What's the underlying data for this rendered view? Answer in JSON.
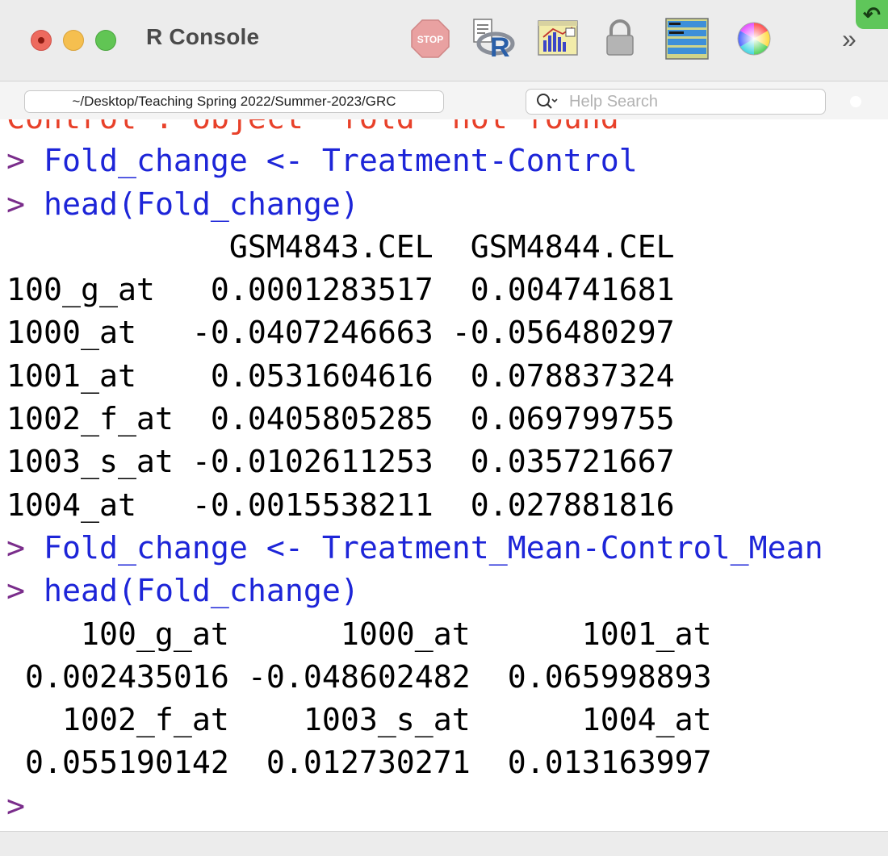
{
  "window": {
    "title": "R Console",
    "traffic_lights": {
      "close": "#ed6a5e",
      "minimize": "#f5bf4f",
      "maximize": "#61c554"
    }
  },
  "toolbar": {
    "items": [
      {
        "name": "stop-icon",
        "label": "STOP"
      },
      {
        "name": "source-script-icon",
        "label": ""
      },
      {
        "name": "quartz-plot-icon",
        "label": ""
      },
      {
        "name": "lock-icon",
        "label": ""
      },
      {
        "name": "console-lines-icon",
        "label": ""
      },
      {
        "name": "color-wheel-icon",
        "label": ""
      }
    ],
    "more_label": "»"
  },
  "path_bar": {
    "working_directory": "~/Desktop/Teaching Spring 2022/Summer-2023/GRC",
    "search_placeholder": "Help Search"
  },
  "colors": {
    "prompt": "#7a2d8b",
    "command": "#1d25d8",
    "error": "#e8412a",
    "output": "#000000"
  },
  "console": {
    "lines": [
      {
        "type": "error",
        "text": "Control : object 'fold' not found"
      },
      {
        "type": "input",
        "prompt": ">",
        "text": "Fold_change <- Treatment-Control"
      },
      {
        "type": "input",
        "prompt": ">",
        "text": "head(Fold_change)"
      },
      {
        "type": "output",
        "text": "            GSM4843.CEL  GSM4844.CEL"
      },
      {
        "type": "output",
        "text": "100_g_at   0.0001283517  0.004741681"
      },
      {
        "type": "output",
        "text": "1000_at   -0.0407246663 -0.056480297"
      },
      {
        "type": "output",
        "text": "1001_at    0.0531604616  0.078837324"
      },
      {
        "type": "output",
        "text": "1002_f_at  0.0405805285  0.069799755"
      },
      {
        "type": "output",
        "text": "1003_s_at -0.0102611253  0.035721667"
      },
      {
        "type": "output",
        "text": "1004_at   -0.0015538211  0.027881816"
      },
      {
        "type": "input",
        "prompt": ">",
        "text": "Fold_change <- Treatment_Mean-Control_Mean"
      },
      {
        "type": "input",
        "prompt": ">",
        "text": "head(Fold_change)"
      },
      {
        "type": "output",
        "text": "    100_g_at      1000_at      1001_at "
      },
      {
        "type": "output",
        "text": " 0.002435016 -0.048602482  0.065998893 "
      },
      {
        "type": "output",
        "text": "   1002_f_at    1003_s_at      1004_at "
      },
      {
        "type": "output",
        "text": " 0.055190142  0.012730271  0.013163997 "
      },
      {
        "type": "prompt",
        "prompt": ">",
        "text": ""
      }
    ]
  }
}
